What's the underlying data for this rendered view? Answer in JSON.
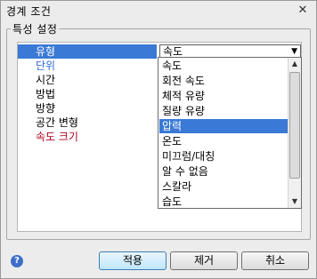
{
  "window": {
    "title": "경계 조건",
    "close": "✕"
  },
  "group": {
    "label": "특성 설정"
  },
  "rows": [
    {
      "name": "유형",
      "value": "속도"
    },
    {
      "name": "단위"
    },
    {
      "name": "시간"
    },
    {
      "name": "방법"
    },
    {
      "name": "방향"
    },
    {
      "name": "공간 변형"
    },
    {
      "name": "속도 크기"
    }
  ],
  "dropdown": {
    "selected": "압력",
    "options": [
      "속도",
      "회전 속도",
      "체적 유량",
      "질량 유량",
      "압력",
      "온도",
      "미끄럼/대칭",
      "알 수 없음",
      "스칼라",
      "습도"
    ]
  },
  "buttons": {
    "apply": "적용",
    "remove": "제거",
    "cancel": "취소"
  },
  "colors": {
    "selection": "#3a79d6",
    "link": "#2e68d8",
    "required": "#b00020"
  }
}
